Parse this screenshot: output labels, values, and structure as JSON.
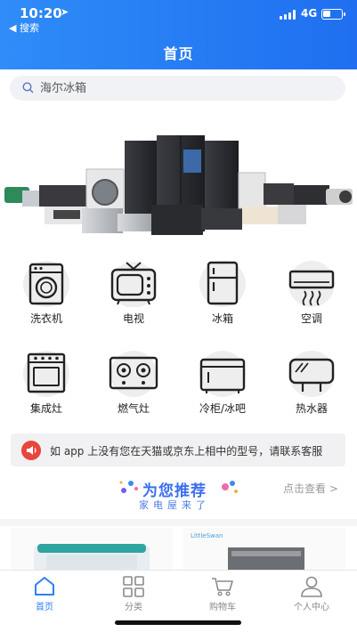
{
  "status_bar": {
    "time": "10:20",
    "back_label": "◀ 搜索",
    "network": "4G"
  },
  "header": {
    "title": "首页"
  },
  "search": {
    "placeholder": "海尔冰箱"
  },
  "categories": [
    {
      "label": "洗衣机",
      "icon": "washing-machine-icon"
    },
    {
      "label": "电视",
      "icon": "tv-icon"
    },
    {
      "label": "冰箱",
      "icon": "fridge-icon"
    },
    {
      "label": "空调",
      "icon": "air-conditioner-icon"
    },
    {
      "label": "集成灶",
      "icon": "integrated-stove-icon"
    },
    {
      "label": "燃气灶",
      "icon": "gas-stove-icon"
    },
    {
      "label": "冷柜/冰吧",
      "icon": "freezer-icon"
    },
    {
      "label": "热水器",
      "icon": "water-heater-icon"
    }
  ],
  "notice": {
    "text": "如 app 上没有您在天猫或京东上相中的型号，请联系客服"
  },
  "recommend": {
    "title": "为您推荐",
    "subtitle": "家电屋来了",
    "more_label": "点击查看 >"
  },
  "products": {
    "right_brand": "LittleSwan"
  },
  "tabbar": [
    {
      "label": "首页",
      "icon": "home-icon",
      "active": true
    },
    {
      "label": "分类",
      "icon": "grid-icon",
      "active": false
    },
    {
      "label": "购物车",
      "icon": "cart-icon",
      "active": false
    },
    {
      "label": "个人中心",
      "icon": "user-icon",
      "active": false
    }
  ],
  "colors": {
    "accent": "#2f7ff5",
    "header_start": "#2f8cf8",
    "header_end": "#1f6ff0",
    "notice_icon": "#e8453c"
  }
}
